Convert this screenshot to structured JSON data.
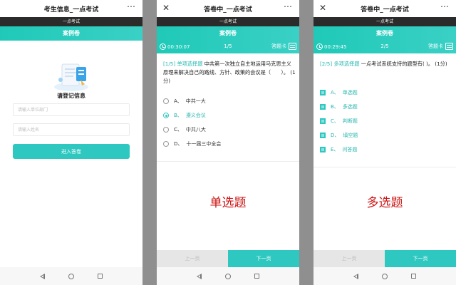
{
  "screens": {
    "login": {
      "window_title": "考生信息_一点考试",
      "brand": "一点考试",
      "header": "案例卷",
      "register_title": "请登记信息",
      "dept_placeholder": "请输入单位部门",
      "name_placeholder": "请输入姓名",
      "enter_button": "进入答卷"
    },
    "single": {
      "window_title": "答卷中_一点考试",
      "brand": "一点考试",
      "header": "案例卷",
      "timer": "00:30:07",
      "progress": "1/5",
      "answer_card": "答题卡",
      "question_tag": "[1/5] 单项选择题",
      "question_text": " 中共第一次独立自主地运用马克思主义原理来解决自己的路线、方针、政策的会议是（　　）。 (1分)",
      "options": [
        {
          "letter": "A、",
          "text": "中共一大",
          "selected": false
        },
        {
          "letter": "B、",
          "text": "遵义会议",
          "selected": true
        },
        {
          "letter": "C、",
          "text": "中共八大",
          "selected": false
        },
        {
          "letter": "D、",
          "text": "十一届三中全会",
          "selected": false
        }
      ],
      "annotation": "单选题",
      "prev_label": "上一页",
      "next_label": "下一页"
    },
    "multi": {
      "window_title": "答卷中_一点考试",
      "brand": "一点考试",
      "header": "案例卷",
      "timer": "00:29:45",
      "progress": "2/5",
      "answer_card": "答题卡",
      "question_tag": "[2/5] 多项选择题",
      "question_text": " 一点考试系统支持的题型有( )。 (1分)",
      "options": [
        {
          "letter": "A、",
          "text": "单选题",
          "selected": true
        },
        {
          "letter": "B、",
          "text": "多选题",
          "selected": true
        },
        {
          "letter": "C、",
          "text": "判断题",
          "selected": true
        },
        {
          "letter": "D、",
          "text": "填空题",
          "selected": true
        },
        {
          "letter": "E、",
          "text": "问答题",
          "selected": true
        }
      ],
      "annotation": "多选题",
      "prev_label": "上一页",
      "next_label": "下一页"
    }
  },
  "colors": {
    "accent": "#2ec8c0",
    "annotation": "#cc1414",
    "brand_bar": "#2b2b2b"
  }
}
